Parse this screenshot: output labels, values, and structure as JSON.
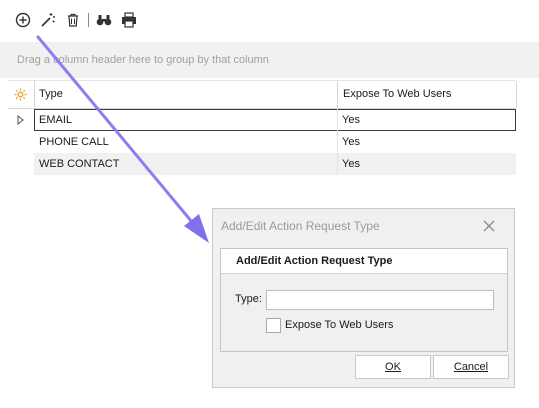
{
  "toolbar": {
    "icons": [
      "add-circle-icon",
      "magic-wand-icon",
      "trash-icon",
      "binoculars-icon",
      "printer-icon"
    ]
  },
  "group_panel": {
    "hint": "Drag a column header here to group by that column"
  },
  "grid": {
    "header_icon": "settings-sun-icon",
    "columns": [
      "Type",
      "Expose To Web Users"
    ],
    "rows": [
      {
        "type": "EMAIL",
        "expose": "Yes"
      },
      {
        "type": "PHONE CALL",
        "expose": "Yes"
      },
      {
        "type": "WEB CONTACT",
        "expose": "Yes"
      }
    ]
  },
  "dialog": {
    "title": "Add/Edit Action Request Type",
    "group_title": "Add/Edit Action Request Type",
    "type_label": "Type:",
    "type_value": "",
    "checkbox_label": "Expose To Web Users",
    "checkbox_checked": false,
    "ok_label": "OK",
    "cancel_label": "Cancel"
  },
  "colors": {
    "arrow": "#8b7ff0",
    "header_icon": "#f0a020"
  }
}
